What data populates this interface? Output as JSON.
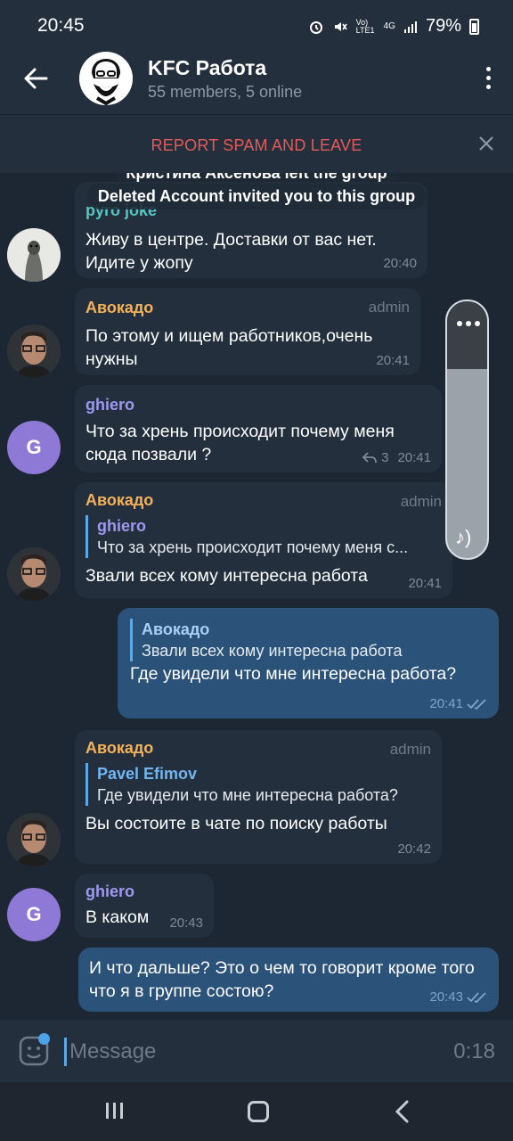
{
  "status": {
    "time": "20:45",
    "network": "Vo) LTE1",
    "net4g": "4G",
    "battery": "79%"
  },
  "header": {
    "title": "KFC Работа",
    "subtitle": "55 members, 5 online"
  },
  "spam_bar": {
    "label": "REPORT SPAM AND LEAVE"
  },
  "service_msgs": [
    "Кристина Аксенова left the group",
    "Deleted Account invited you to this group"
  ],
  "messages": [
    {
      "sender": "pyro joke",
      "text": "Живу в центре. Доставки от вас нет. Идите у жопу",
      "time": "20:40"
    },
    {
      "sender": "Авокадо",
      "role": "admin",
      "text": "По этому и ищем работников,очень нужны",
      "time": "20:41"
    },
    {
      "sender": "ghiero",
      "avatar_letter": "G",
      "text": "Что за хрень происходит почему меня сюда позвали ?",
      "replies": "3",
      "time": "20:41"
    },
    {
      "sender": "Авокадо",
      "role": "admin",
      "reply_name": "ghiero",
      "reply_text": "Что за хрень происходит почему меня с...",
      "text": "Звали всех кому интересна работа",
      "time": "20:41"
    },
    {
      "reply_name": "Авокадо",
      "reply_text": "Звали всех кому интересна работа",
      "text": "Где  увидели что мне интересна работа?",
      "time": "20:41"
    },
    {
      "sender": "Авокадо",
      "role": "admin",
      "reply_name": "Pavel Efimov",
      "reply_text": "Где  увидели что мне интересна работа?",
      "text": "Вы состоите в чате по поиску работы",
      "time": "20:42"
    },
    {
      "sender": "ghiero",
      "avatar_letter": "G",
      "text": "В каком",
      "time": "20:43"
    },
    {
      "text": "И что дальше?  Это  о чем то говорит кроме того что я в группе состою?",
      "time": "20:43"
    }
  ],
  "input": {
    "placeholder": "Message",
    "timer": "0:18"
  },
  "colors": {
    "accent": "#5ea8e6",
    "admin_name": "#f2b25c",
    "ghiero_name": "#9f98f0",
    "pyro_name": "#54c6c4",
    "spam": "#e35a58"
  }
}
